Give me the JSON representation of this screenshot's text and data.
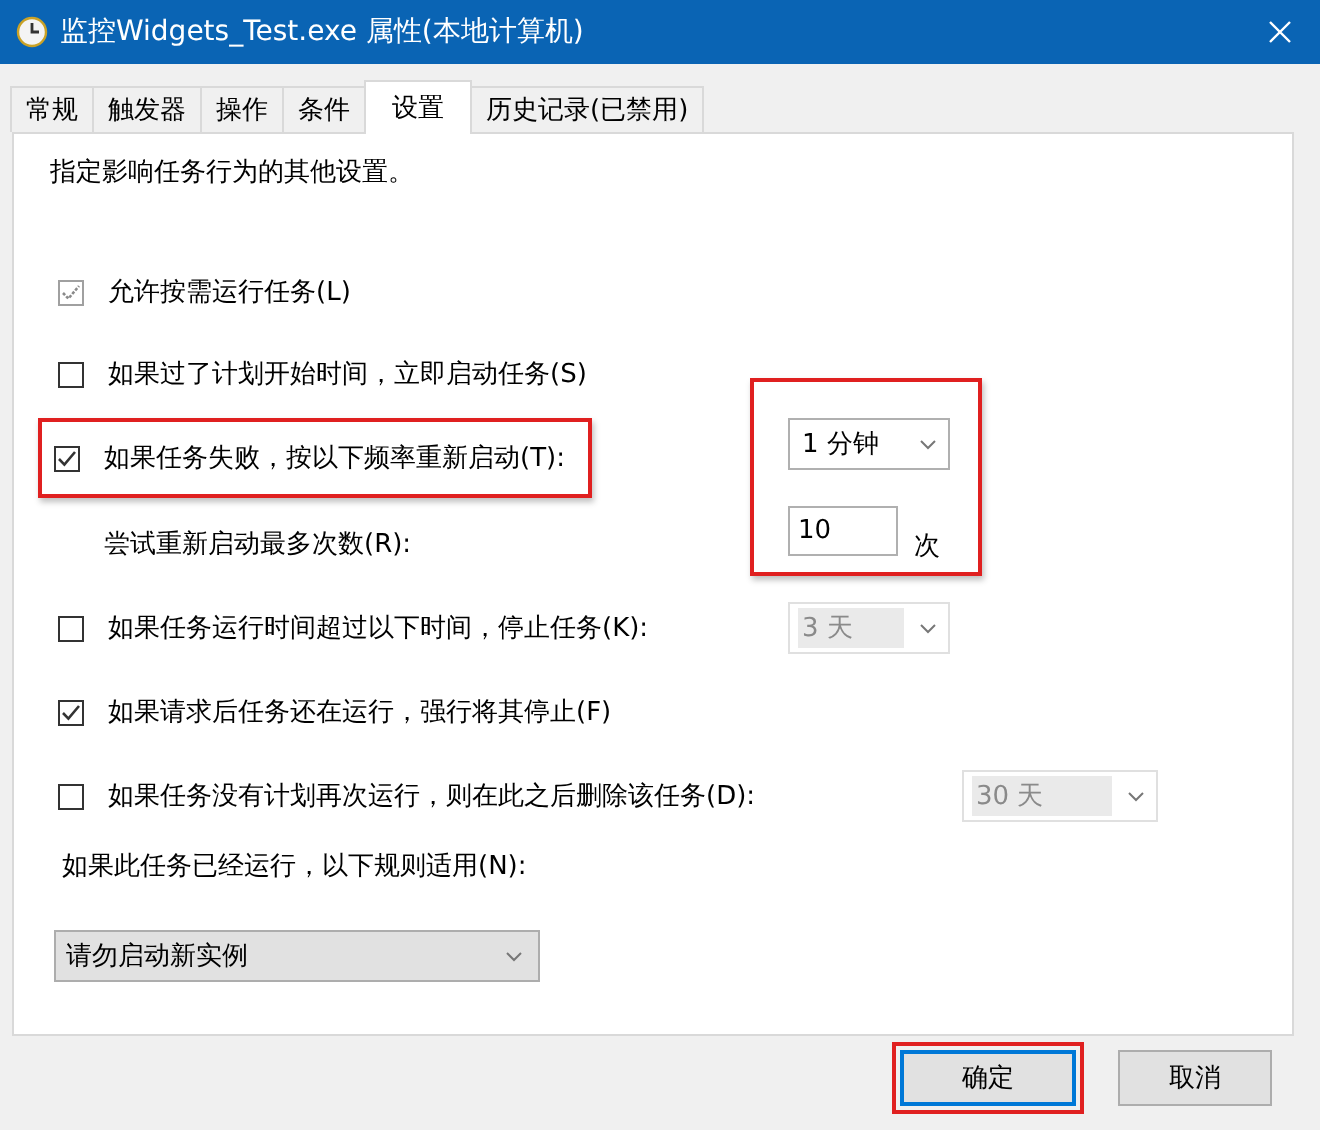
{
  "window": {
    "title": "监控Widgets_Test.exe 属性(本地计算机)"
  },
  "tabs": [
    {
      "label": "常规",
      "selected": false
    },
    {
      "label": "触发器",
      "selected": false
    },
    {
      "label": "操作",
      "selected": false
    },
    {
      "label": "条件",
      "selected": false
    },
    {
      "label": "设置",
      "selected": true
    },
    {
      "label": "历史记录(已禁用)",
      "selected": false
    }
  ],
  "description": "指定影响任务行为的其他设置。",
  "options": [
    {
      "kind": "checkbox",
      "label": "允许按需运行任务(L)",
      "checked": true,
      "disabled": true,
      "highlighted": false
    },
    {
      "kind": "checkbox",
      "label": "如果过了计划开始时间，立即启动任务(S)",
      "checked": false,
      "disabled": false,
      "highlighted": false
    },
    {
      "kind": "checkbox",
      "label": "如果任务失败，按以下频率重新启动(T):",
      "checked": true,
      "disabled": false,
      "highlighted": true
    },
    {
      "kind": "sublabel",
      "label": "尝试重新启动最多次数(R):"
    },
    {
      "kind": "checkbox",
      "label": "如果任务运行时间超过以下时间，停止任务(K):",
      "checked": false,
      "disabled": false,
      "highlighted": false
    },
    {
      "kind": "checkbox",
      "label": "如果请求后任务还在运行，强行将其停止(F)",
      "checked": true,
      "disabled": false,
      "highlighted": false
    },
    {
      "kind": "checkbox",
      "label": "如果任务没有计划再次运行，则在此之后删除该任务(D):",
      "checked": false,
      "disabled": false,
      "highlighted": false
    },
    {
      "kind": "label",
      "label": "如果此任务已经运行，以下规则适用(N):"
    }
  ],
  "restart_settings": {
    "highlighted": true,
    "interval": {
      "value": "1 分钟",
      "disabled": false
    },
    "max_retries": {
      "value": "10",
      "unit": "次"
    }
  },
  "stop_after": {
    "value": "3 天",
    "disabled": true
  },
  "delete_after": {
    "value": "30 天",
    "disabled": true
  },
  "rule": {
    "value": "请勿启动新实例"
  },
  "buttons": [
    {
      "label": "确定",
      "focused": true,
      "highlighted": true
    },
    {
      "label": "取消",
      "focused": false,
      "highlighted": false
    }
  ]
}
